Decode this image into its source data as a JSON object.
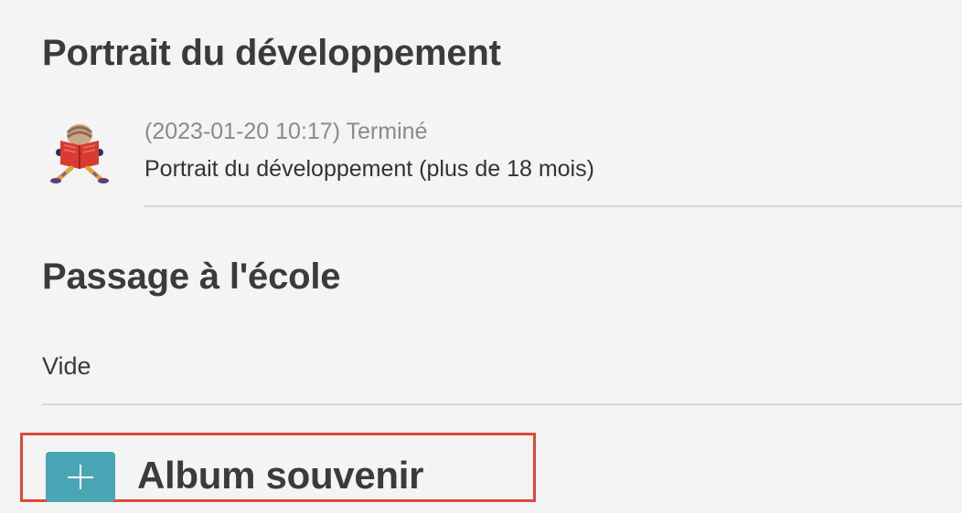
{
  "sections": {
    "development": {
      "title": "Portrait du développement",
      "entries": [
        {
          "meta": "(2023-01-20 10:17) Terminé",
          "description": "Portrait du développement (plus de 18 mois)",
          "icon": "reading-child-icon"
        }
      ]
    },
    "school": {
      "title": "Passage à l'école",
      "empty_text": "Vide"
    }
  },
  "album_button": {
    "label": "Album souvenir",
    "icon": "plus-icon",
    "accent_color": "#4aa5b4",
    "highlight_color": "#e0473a"
  }
}
